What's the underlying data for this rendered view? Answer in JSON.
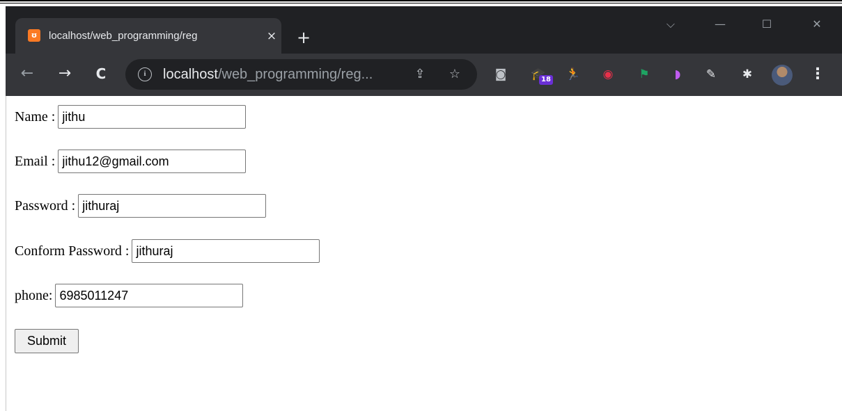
{
  "tab": {
    "favicon": "xampp-icon",
    "title": "localhost/web_programming/reg",
    "close": "×"
  },
  "new_tab": "+",
  "window_controls": {
    "minimize": "—",
    "maximize": "☐",
    "close": "✕",
    "dropdown": "⌵"
  },
  "nav": {
    "back": "←",
    "forward": "→",
    "reload": "C"
  },
  "omnibox": {
    "host": "localhost",
    "path": "/web_programming/reg...",
    "info": "i",
    "share": "⇪",
    "star": "☆"
  },
  "extensions": [
    {
      "name": "camera-extension-icon",
      "glyph": "◙",
      "color": "#bdc1c6"
    },
    {
      "name": "graduation-cap-extension-icon",
      "glyph": "🎓",
      "color": "#6a5ae0"
    },
    {
      "name": "runner-extension-icon",
      "glyph": "🏃",
      "color": "#1ec8a0"
    },
    {
      "name": "red-circle-extension-icon",
      "glyph": "◉",
      "color": "#e8304a"
    },
    {
      "name": "flag-extension-icon",
      "glyph": "⚑",
      "color": "#1ea362"
    },
    {
      "name": "pink-shape-extension-icon",
      "glyph": "◗",
      "color": "#c05cf0"
    },
    {
      "name": "pen-extension-icon",
      "glyph": "✎",
      "color": "#e8eaed"
    },
    {
      "name": "puzzle-extension-icon",
      "glyph": "✱",
      "color": "#e8eaed"
    }
  ],
  "extension_badge": "18",
  "menu": "⋮",
  "form": {
    "name_label": "Name :",
    "name_value": "jithu",
    "email_label": "Email :",
    "email_value": "jithu12@gmail.com",
    "password_label": "Password :",
    "password_value": "jithuraj",
    "confirm_label": "Conform Password :",
    "confirm_value": "jithuraj",
    "phone_label": "phone:",
    "phone_value": "6985011247",
    "submit_label": "Submit"
  }
}
